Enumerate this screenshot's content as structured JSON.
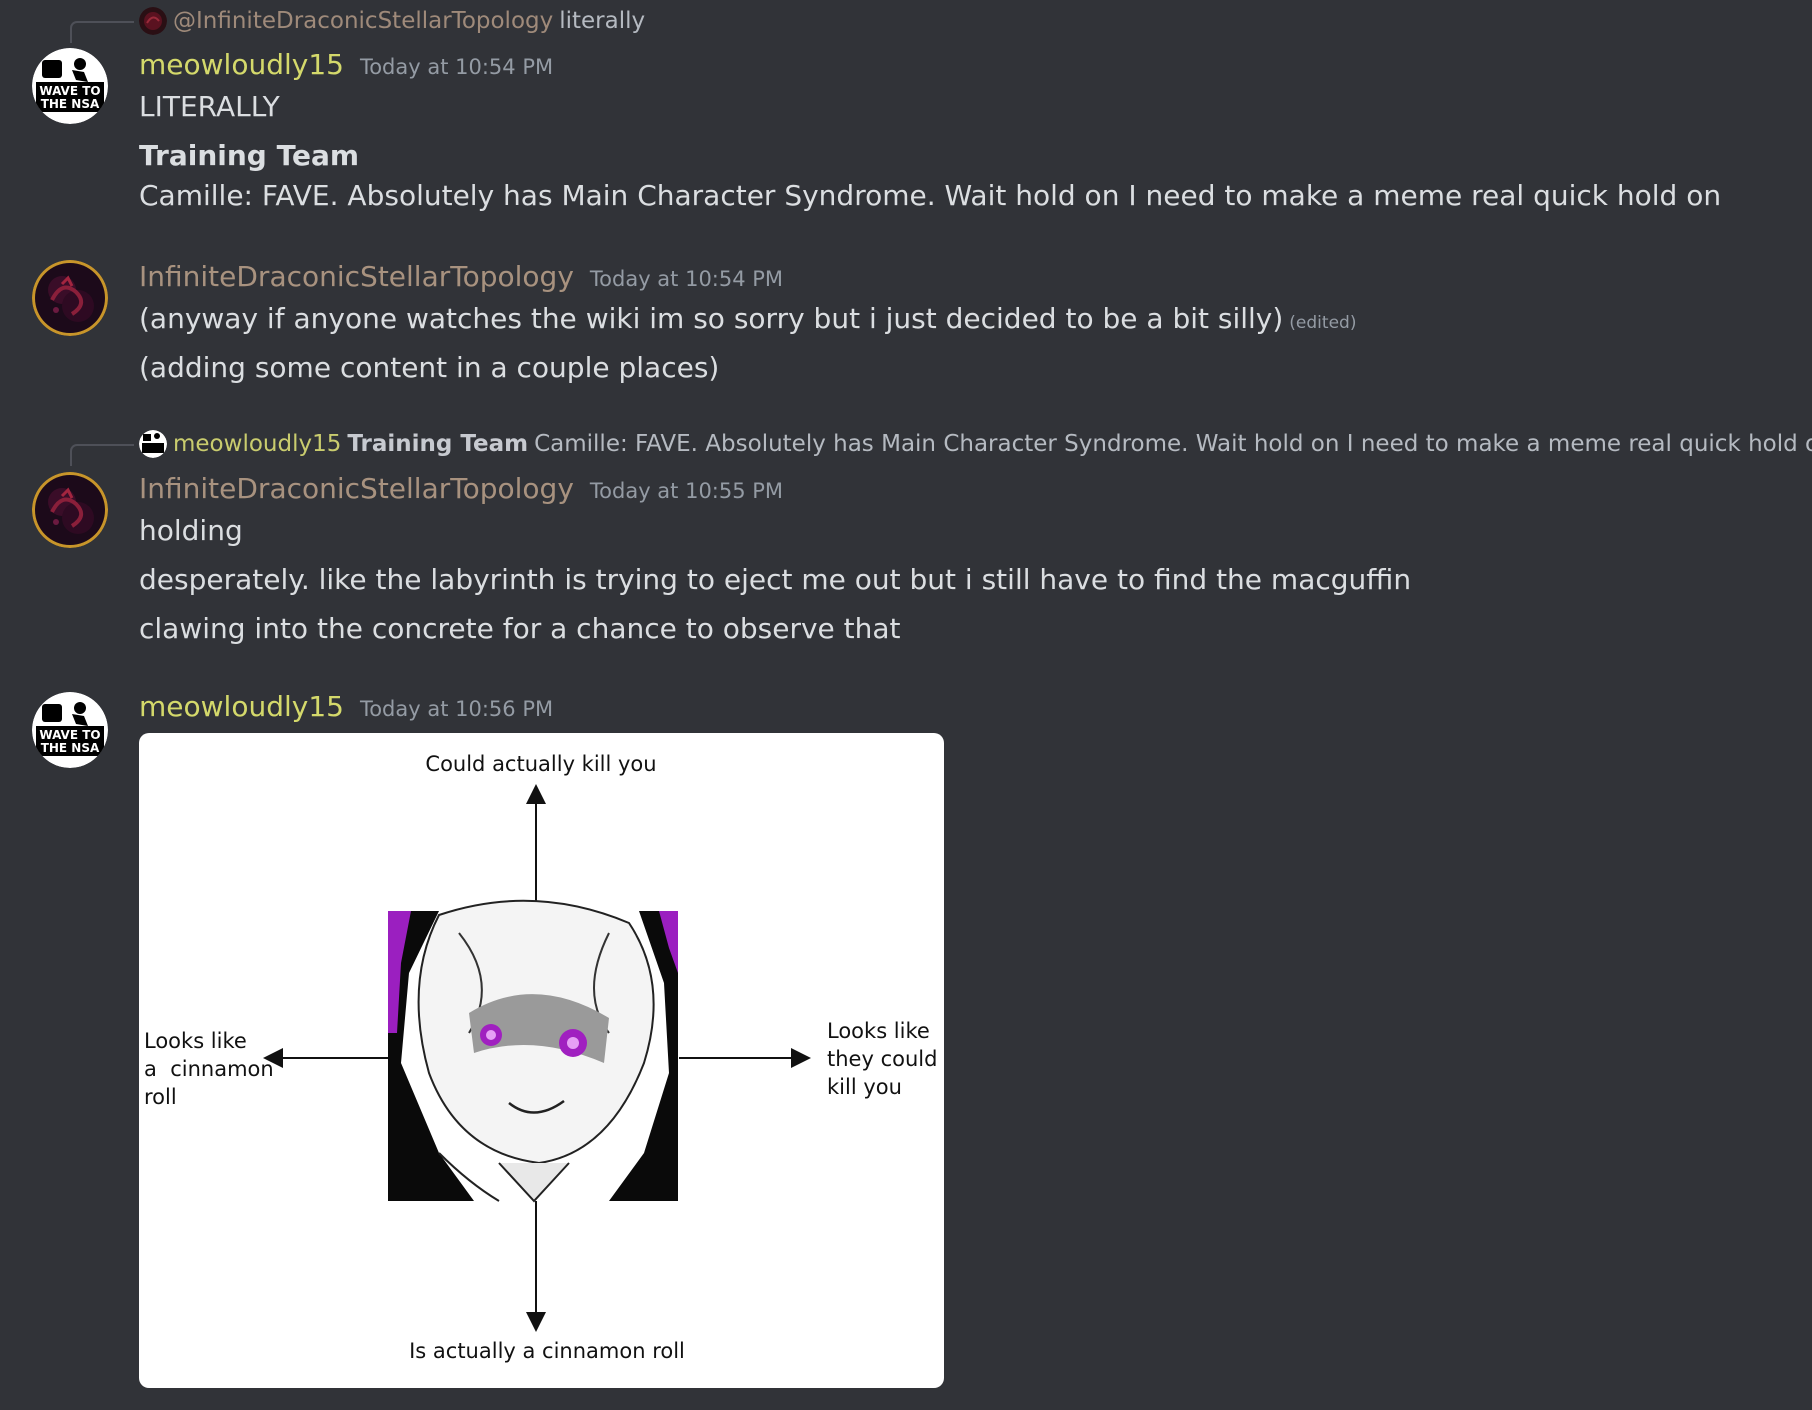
{
  "messages": [
    {
      "reply": {
        "mention": "@InfiniteDraconicStellarTopology",
        "text": "literally"
      },
      "author": "meowloudly15",
      "timestamp": "Today at 10:54 PM",
      "lines": [
        "LITERALLY"
      ],
      "heading": "Training Team",
      "extra": "Camille: FAVE. Absolutely has Main Character Syndrome. Wait hold on I need to make a meme real quick hold on",
      "avatar_text": [
        "WAVE TO",
        "THE NSA"
      ]
    },
    {
      "author": "InfiniteDraconicStellarTopology",
      "timestamp": "Today at 10:54 PM",
      "lines": [
        "(anyway if anyone watches the wiki im so sorry but i just decided to be a bit silly)",
        "(adding some content in a couple places)"
      ],
      "edited_label": "(edited)"
    },
    {
      "reply": {
        "author": "meowloudly15",
        "heading": "Training Team",
        "text": "Camille: FAVE. Absolutely has Main Character Syndrome. Wait hold on I need to make a meme real quick hold on"
      },
      "author": "InfiniteDraconicStellarTopology",
      "timestamp": "Today at 10:55 PM",
      "lines": [
        "holding",
        "desperately. like the labyrinth is trying to eject me out but i still have to find the macguffin",
        "clawing into the concrete for a chance to observe that"
      ]
    },
    {
      "author": "meowloudly15",
      "timestamp": "Today at 10:56 PM",
      "image": {
        "top_label": "Could actually kill you",
        "left_label": [
          "Looks like",
          "a  cinnamon",
          "roll"
        ],
        "right_label": [
          "Looks like",
          "they could",
          "kill you"
        ],
        "bottom_label": "Is actually a cinnamon roll"
      }
    }
  ],
  "colors": {
    "background": "#313338",
    "meowloudly15_name": "#d4d96b",
    "infinite_name": "#a8927f",
    "timestamp": "#949ba4",
    "text": "#dbdee1"
  }
}
